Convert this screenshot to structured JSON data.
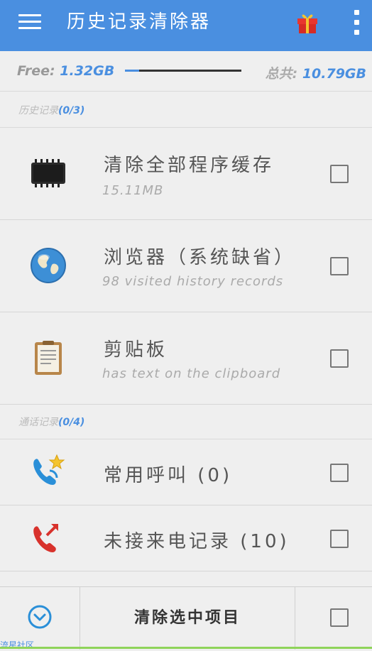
{
  "appbar": {
    "title": "历史记录清除器",
    "menu_icon": "menu-icon",
    "gift_icon": "gift-icon",
    "more_icon": "more-vert-icon",
    "color": "#4a8fe0"
  },
  "storage": {
    "free_label": "Free:",
    "free_value": "1.32GB",
    "total_label": "总共:",
    "total_value": "10.79GB",
    "used_fraction": 0.12
  },
  "sections": {
    "history": {
      "label": "历史记录",
      "count": "(0/3)"
    },
    "calls": {
      "label": "通话记录",
      "count": "(0/4)"
    }
  },
  "items": [
    {
      "title": "清除全部程序缓存",
      "subtitle": "15.11MB",
      "icon": "memory-chip-icon",
      "checked": false
    },
    {
      "title": "浏览器（系统缺省）",
      "subtitle": "98 visited history records",
      "icon": "globe-icon",
      "checked": false
    },
    {
      "title": "剪贴板",
      "subtitle": "has text on the clipboard",
      "icon": "clipboard-icon",
      "checked": false
    },
    {
      "title": "常用呼叫 (0)",
      "subtitle": "",
      "icon": "phone-star-icon",
      "checked": false
    },
    {
      "title": "未接来电记录 (10)",
      "subtitle": "",
      "icon": "missed-call-icon",
      "checked": false
    }
  ],
  "bottom": {
    "clear_label": "清除选中项目",
    "expand_icon": "chevron-down-circle-icon",
    "watermark": "流星社区"
  }
}
